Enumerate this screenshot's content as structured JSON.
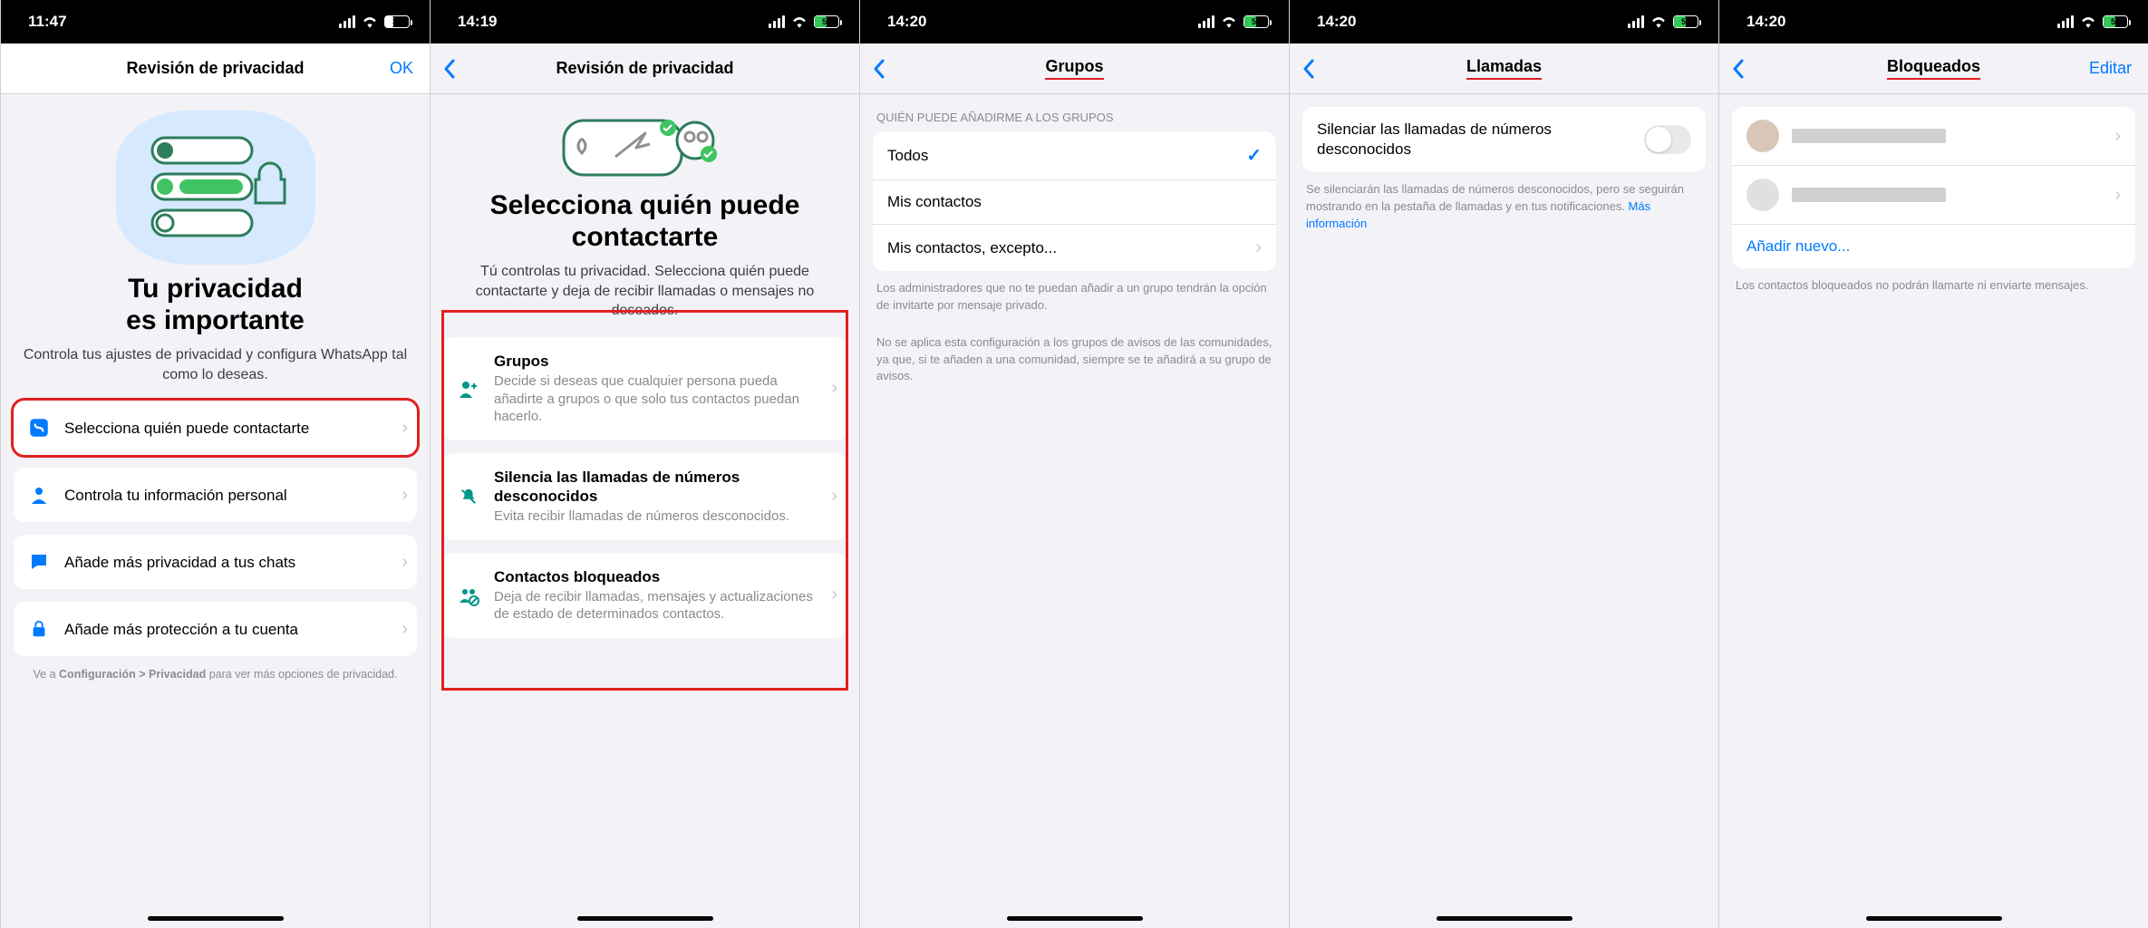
{
  "colors": {
    "accent": "#007aff",
    "highlight": "#e02020",
    "green": "#34c759"
  },
  "pane1": {
    "status_time": "11:47",
    "battery_pct": "35",
    "nav_title": "Revisión de privacidad",
    "nav_right": "OK",
    "title": "Tu privacidad\nes importante",
    "subtitle": "Controla tus ajustes de privacidad y configura WhatsApp tal como lo deseas.",
    "cards": [
      {
        "icon": "phone-contact-icon",
        "title": "Selecciona quién puede contactarte",
        "highlight": true
      },
      {
        "icon": "person-icon",
        "title": "Controla tu información personal"
      },
      {
        "icon": "chat-bubble-icon",
        "title": "Añade más privacidad a tus chats"
      },
      {
        "icon": "lock-icon",
        "title": "Añade más protección a tu cuenta"
      }
    ],
    "footnote_prefix": "Ve a ",
    "footnote_bold": "Configuración > Privacidad",
    "footnote_suffix": " para ver más opciones de privacidad."
  },
  "pane2": {
    "status_time": "14:19",
    "battery_pct": "50",
    "nav_title": "Revisión de privacidad",
    "title": "Selecciona quién puede contactarte",
    "subtitle": "Tú controlas tu privacidad. Selecciona quién puede contactarte y deja de recibir llamadas o mensajes no deseados.",
    "cards": [
      {
        "icon": "group-add-icon",
        "title": "Grupos",
        "desc": "Decide si deseas que cualquier persona pueda añadirte a grupos o que solo tus contactos puedan hacerlo."
      },
      {
        "icon": "mute-bell-icon",
        "title": "Silencia las llamadas de números desconocidos",
        "desc": "Evita recibir llamadas de números desconocidos."
      },
      {
        "icon": "blocked-contacts-icon",
        "title": "Contactos bloqueados",
        "desc": "Deja de recibir llamadas, mensajes y actualizaciones de estado de determinados contactos."
      }
    ]
  },
  "pane3": {
    "status_time": "14:20",
    "battery_pct": "51",
    "nav_title": "Grupos",
    "section_header": "QUIÉN PUEDE AÑADIRME A LOS GRUPOS",
    "options": [
      {
        "label": "Todos",
        "selected": true
      },
      {
        "label": "Mis contactos",
        "selected": false
      },
      {
        "label": "Mis contactos, excepto...",
        "selected": false,
        "chevron": true
      }
    ],
    "footer1": "Los administradores que no te puedan añadir a un grupo tendrán la opción de invitarte por mensaje privado.",
    "footer2": "No se aplica esta configuración a los grupos de avisos de las comunidades, ya que, si te añaden a una comunidad, siempre se te añadirá a su grupo de avisos."
  },
  "pane4": {
    "status_time": "14:20",
    "battery_pct": "51",
    "nav_title": "Llamadas",
    "toggle_label": "Silenciar las llamadas de números desconocidos",
    "toggle_on": false,
    "footer": "Se silenciarán las llamadas de números desconocidos, pero se seguirán mostrando en la pestaña de llamadas y en tus notificaciones. ",
    "footer_link": "Más información"
  },
  "pane5": {
    "status_time": "14:20",
    "battery_pct": "51",
    "nav_title": "Bloqueados",
    "nav_right": "Editar",
    "rows": [
      {
        "avatar": "#d8c7b8"
      },
      {
        "avatar": "#e0e0e0"
      }
    ],
    "add_new": "Añadir nuevo...",
    "footer": "Los contactos bloqueados no podrán llamarte ni enviarte mensajes."
  }
}
